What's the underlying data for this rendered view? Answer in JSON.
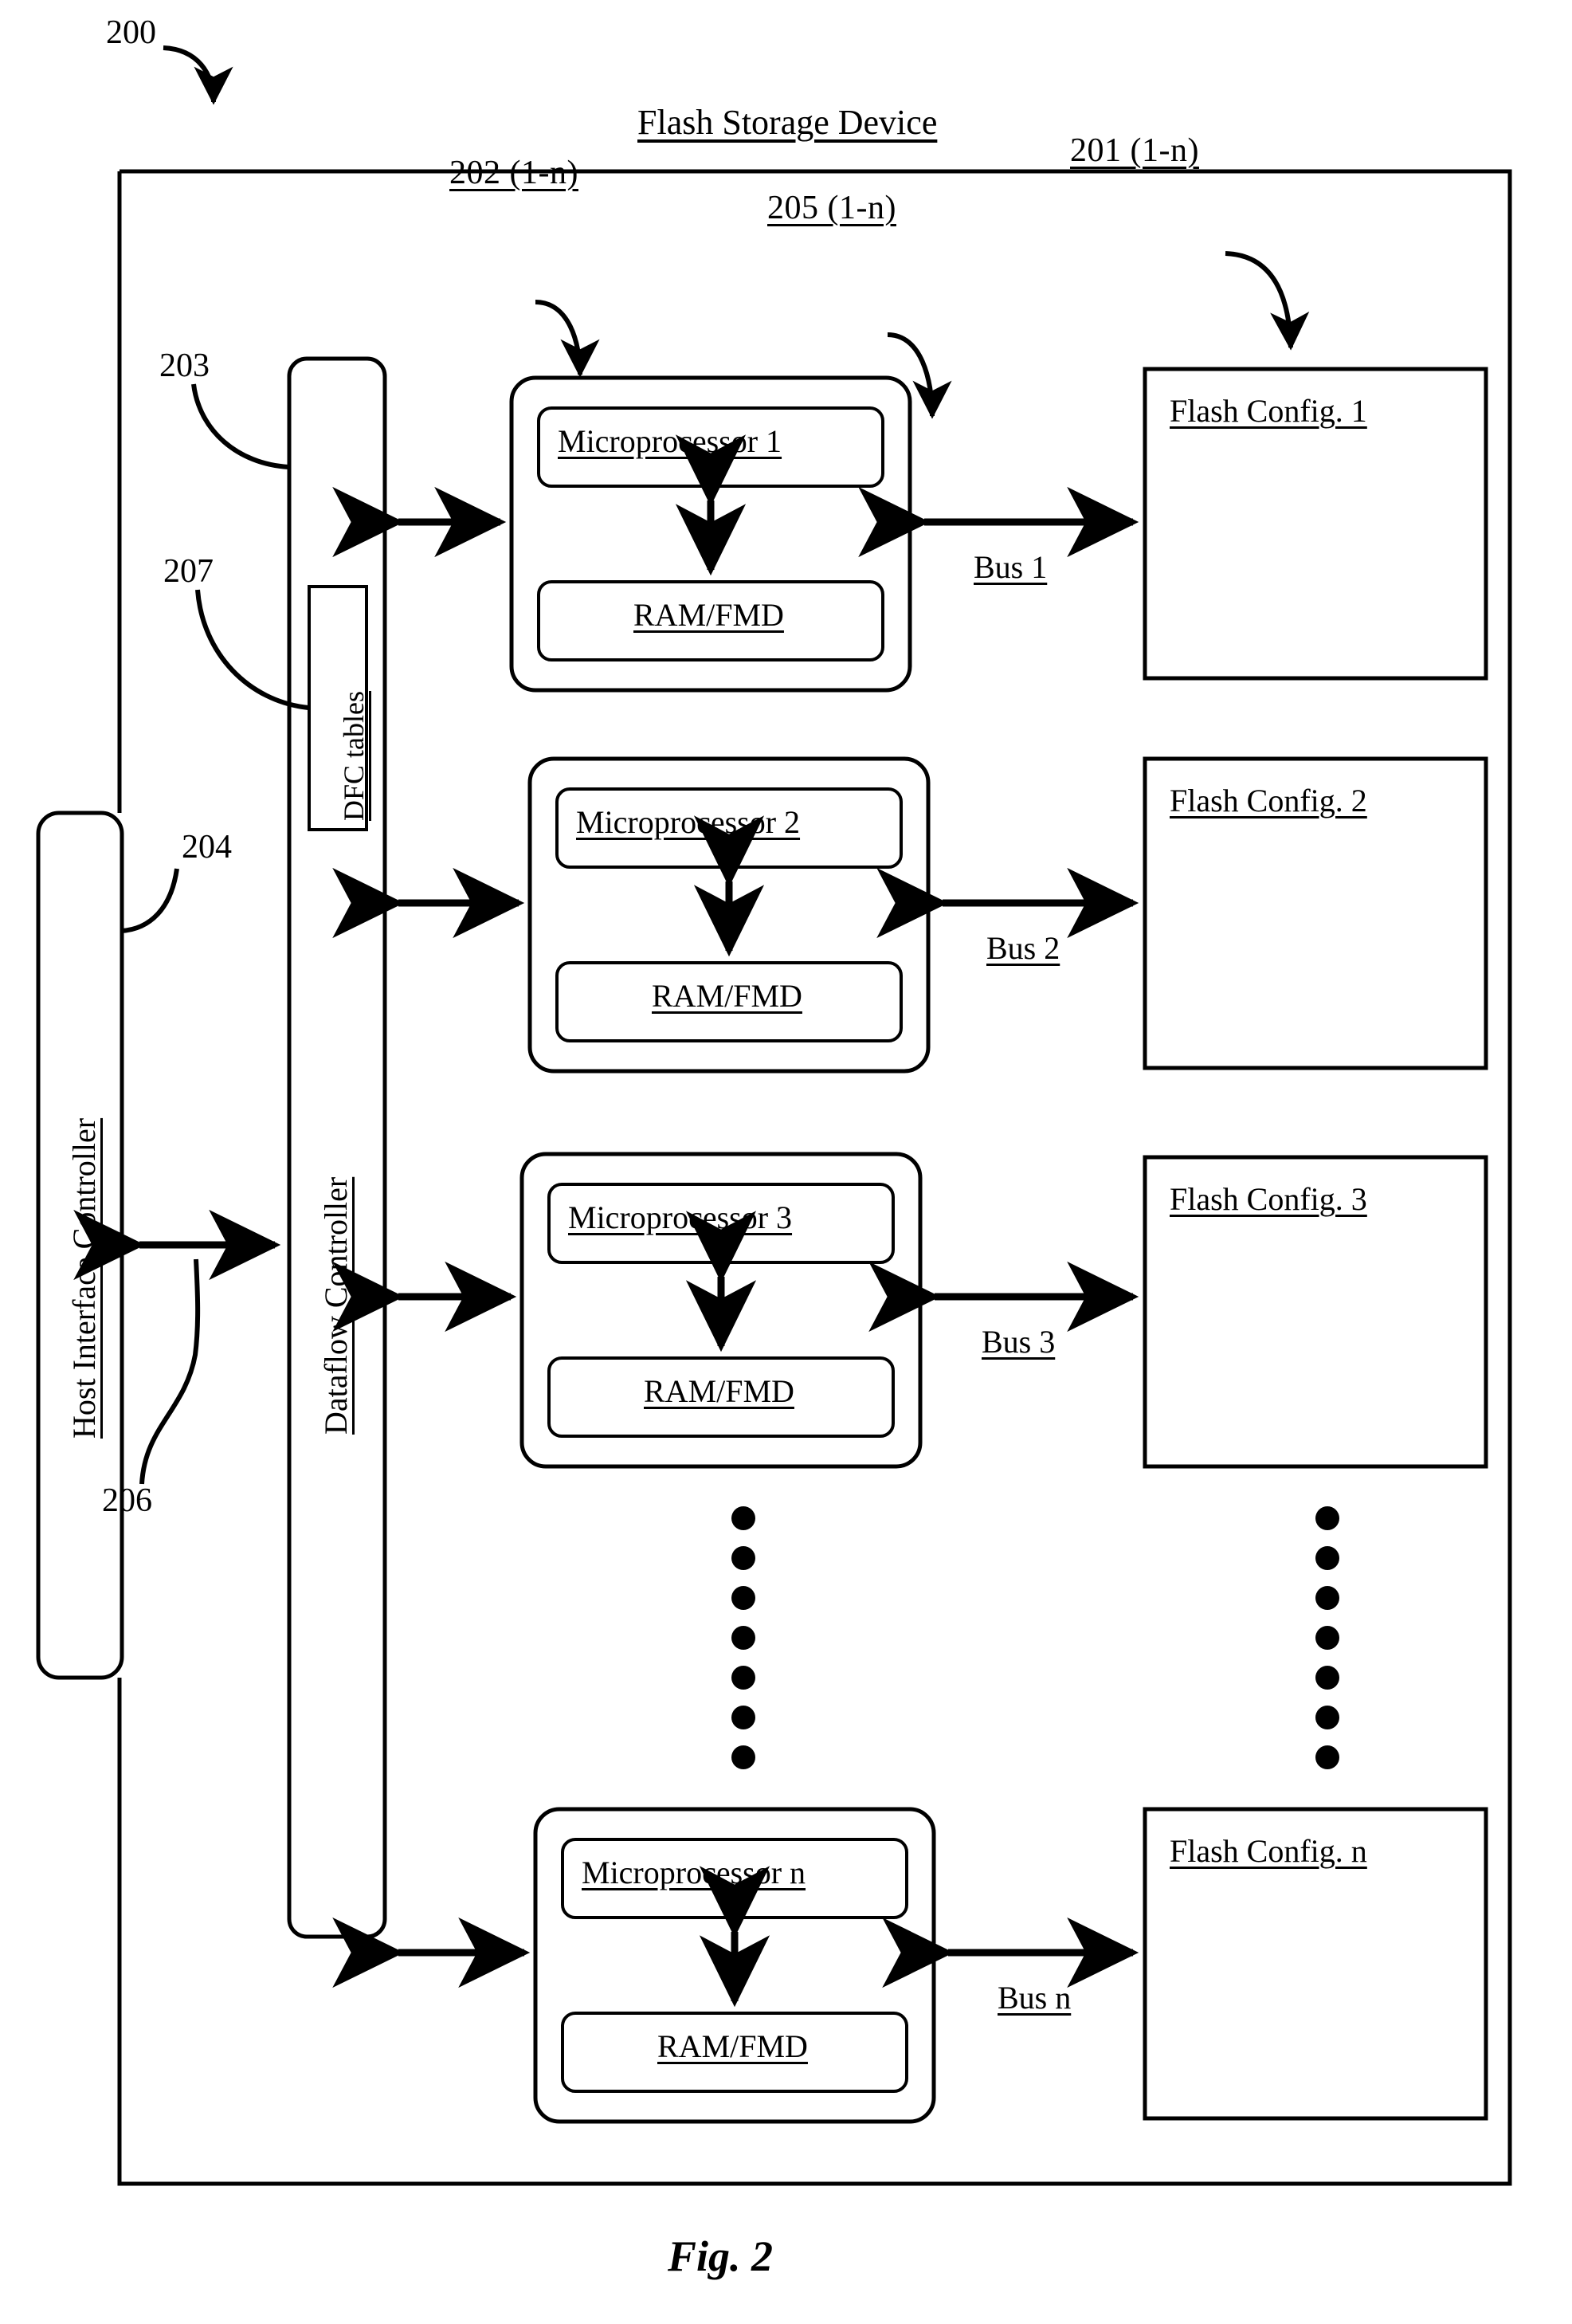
{
  "figure": {
    "caption": "Fig. 2",
    "system_ref": "200",
    "device_title": "Flash Storage Device"
  },
  "refs": {
    "system": "200",
    "flash_configs": "201 (1-n)",
    "processor_units": "202 (1-n)",
    "dfc_tables": "207",
    "dataflow_controller": "203",
    "host_interface_controller": "204",
    "buses": "205 (1-n)",
    "host_link": "206"
  },
  "host_interface_controller": {
    "label": "Host Interface Controller"
  },
  "dataflow_controller": {
    "label": "Dataflow Controller",
    "dfc_tables_label": "DFC tables"
  },
  "processor_units": [
    {
      "processor": "Microprocessor 1",
      "memory": "RAM/FMD"
    },
    {
      "processor": "Microprocessor 2",
      "memory": "RAM/FMD"
    },
    {
      "processor": "Microprocessor 3",
      "memory": "RAM/FMD"
    },
    {
      "processor": "Microprocessor n",
      "memory": "RAM/FMD"
    }
  ],
  "buses": [
    {
      "label": "Bus 1"
    },
    {
      "label": "Bus 2"
    },
    {
      "label": "Bus 3"
    },
    {
      "label": "Bus n"
    }
  ],
  "flash_configs": [
    {
      "label": "Flash Config. 1"
    },
    {
      "label": "Flash Config. 2"
    },
    {
      "label": "Flash Config. 3"
    },
    {
      "label": "Flash Config. n"
    }
  ],
  "ellipsis": {
    "dot_count": 7,
    "columns": [
      "processor-column",
      "flash-config-column"
    ]
  },
  "colors": {
    "ink": "#000000",
    "paper": "#ffffff"
  }
}
